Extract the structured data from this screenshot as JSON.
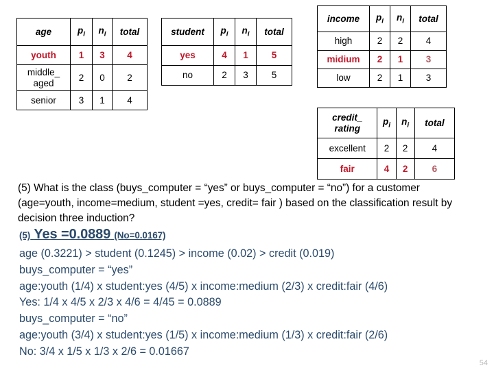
{
  "tables": [
    {
      "id": "age",
      "headers": [
        "age",
        "p",
        "n",
        "total"
      ],
      "rows": [
        {
          "highlight": true,
          "cells": [
            "youth",
            "1",
            "3",
            "4"
          ]
        },
        {
          "highlight": false,
          "cells": [
            "middle_ aged",
            "2",
            "0",
            "2"
          ]
        },
        {
          "highlight": false,
          "cells": [
            "senior",
            "3",
            "1",
            "4"
          ]
        }
      ]
    },
    {
      "id": "student",
      "headers": [
        "student",
        "p",
        "n",
        "total"
      ],
      "rows": [
        {
          "highlight": true,
          "cells": [
            "yes",
            "4",
            "1",
            "5"
          ]
        },
        {
          "highlight": false,
          "cells": [
            "no",
            "2",
            "3",
            "5"
          ]
        }
      ]
    },
    {
      "id": "income",
      "headers": [
        "income",
        "p",
        "n",
        "total"
      ],
      "rows": [
        {
          "highlight": false,
          "cells": [
            "high",
            "2",
            "2",
            "4"
          ]
        },
        {
          "highlight": true,
          "cells": [
            "midium",
            "2",
            "1",
            "3"
          ]
        },
        {
          "highlight": false,
          "cells": [
            "low",
            "2",
            "1",
            "3"
          ]
        }
      ]
    },
    {
      "id": "credit",
      "headers": [
        "credit_ rating",
        "p",
        "n",
        "total"
      ],
      "rows": [
        {
          "highlight": false,
          "cells": [
            "excellent",
            "2",
            "2",
            "4"
          ]
        },
        {
          "highlight": true,
          "cells": [
            "fair",
            "4",
            "2",
            "6"
          ]
        }
      ]
    }
  ],
  "table_age": {
    "header": {
      "c1": "age",
      "c2": "p",
      "c3": "n",
      "c4": "total"
    },
    "rows": [
      {
        "c1": "youth",
        "c2": "1",
        "c3": "3",
        "c4": "4"
      },
      {
        "c1a": "middle_",
        "c1b": "aged",
        "c2": "2",
        "c3": "0",
        "c4": "2"
      },
      {
        "c1": "senior",
        "c2": "3",
        "c3": "1",
        "c4": "4"
      }
    ]
  },
  "table_student": {
    "header": {
      "c1": "student",
      "c2": "p",
      "c3": "n",
      "c4": "total"
    },
    "rows": [
      {
        "c1": "yes",
        "c2": "4",
        "c3": "1",
        "c4": "5"
      },
      {
        "c1": "no",
        "c2": "2",
        "c3": "3",
        "c4": "5"
      }
    ]
  },
  "table_income": {
    "header": {
      "c1": "income",
      "c2": "p",
      "c3": "n",
      "c4": "total"
    },
    "rows": [
      {
        "c1": "high",
        "c2": "2",
        "c3": "2",
        "c4": "4"
      },
      {
        "c1": "midium",
        "c2": "2",
        "c3": "1",
        "c4": "3"
      },
      {
        "c1": "low",
        "c2": "2",
        "c3": "1",
        "c4": "3"
      }
    ]
  },
  "table_credit": {
    "header": {
      "c1a": "credit_",
      "c1b": "rating",
      "c2": "p",
      "c3": "n",
      "c4": "total"
    },
    "rows": [
      {
        "c1": "excellent",
        "c2": "2",
        "c3": "2",
        "c4": "4"
      },
      {
        "c1": "fair",
        "c2": "4",
        "c3": "2",
        "c4": "6"
      }
    ]
  },
  "question": {
    "text": "(5) What is the class (buys_computer = “yes” or buys_computer = “no”) for a customer (age=youth, income=medium, student =yes, credit= fair ) based on the classification result by decision three induction?"
  },
  "answer": {
    "heading_prefix": "(5)",
    "heading_main": "Yes =0.0889",
    "heading_suffix": "(No=0.0167)",
    "lines": [
      "age (0.3221) > student (0.1245) > income (0.02) > credit (0.019)",
      "buys_computer = “yes”",
      "age:youth (1/4) x student:yes (4/5) x income:medium (2/3) x credit:fair (4/6)",
      "Yes: 1/4 x 4/5 x 2/3 x 4/6 = 4/45 = 0.0889",
      "buys_computer = “no”",
      "age:youth (3/4) x student:yes (1/5) x income:medium (1/3) x credit:fair (2/6)",
      "No: 3/4 x 1/5 x 1/3 x 2/6 = 0.01667"
    ]
  },
  "page_number": "54",
  "colors": {
    "highlight_red": "#c0182a",
    "answer_blue": "#2b4a6b",
    "page_number_gray": "#b8b8b8",
    "border_black": "#000000"
  }
}
